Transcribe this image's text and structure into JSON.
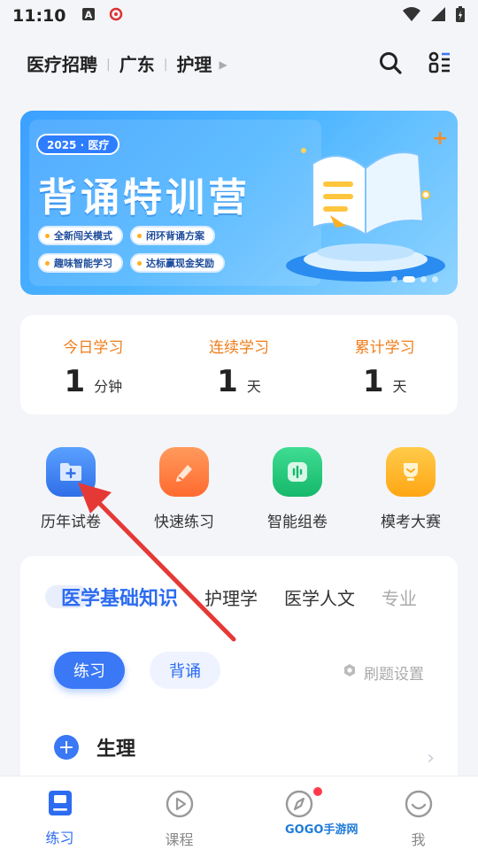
{
  "status_bar": {
    "time": "11:10"
  },
  "header": {
    "breadcrumbs": [
      "医疗招聘",
      "广东",
      "护理"
    ]
  },
  "banner": {
    "badge": "2025 · 医疗",
    "title": "背诵特训营",
    "tags": [
      "全新闯关模式",
      "闭环背诵方案",
      "趣味智能学习",
      "达标赢现金奖励"
    ]
  },
  "stats": [
    {
      "label": "今日学习",
      "value": "1",
      "unit": "分钟"
    },
    {
      "label": "连续学习",
      "value": "1",
      "unit": "天"
    },
    {
      "label": "累计学习",
      "value": "1",
      "unit": "天"
    }
  ],
  "quick_actions": [
    {
      "label": "历年试卷",
      "icon": "folder-plus-icon",
      "color": "#3b82f6"
    },
    {
      "label": "快速练习",
      "icon": "pencil-icon",
      "color": "#ff7a3d"
    },
    {
      "label": "智能组卷",
      "icon": "voice-chart-icon",
      "color": "#21c47a"
    },
    {
      "label": "模考大赛",
      "icon": "trophy-icon",
      "color": "#ffb21e"
    }
  ],
  "subject_tabs": [
    "医学基础知识",
    "护理学",
    "医学人文",
    "专业"
  ],
  "modes": {
    "practice": "练习",
    "recite": "背诵"
  },
  "settings_label": "刷题设置",
  "chapter": {
    "name": "生理"
  },
  "tab_bar": [
    {
      "label": "练习"
    },
    {
      "label": "课程"
    },
    {
      "label": ""
    },
    {
      "label": "我"
    }
  ],
  "watermark": "GOGO手游网",
  "colors": {
    "accent": "#2d6cf0",
    "stat_label": "#f07d1a"
  }
}
